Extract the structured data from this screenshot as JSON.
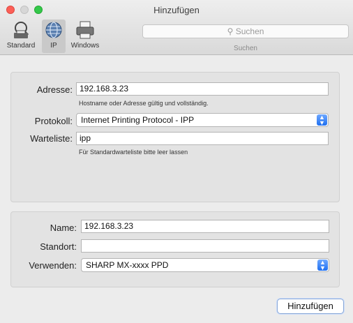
{
  "window": {
    "title": "Hinzufügen"
  },
  "toolbar": {
    "items": [
      {
        "label": "Standard",
        "icon": "default-printer-icon"
      },
      {
        "label": "IP",
        "icon": "globe-icon"
      },
      {
        "label": "Windows",
        "icon": "windows-printer-icon"
      }
    ],
    "search_placeholder": "Suchen",
    "search_caption": "Suchen"
  },
  "connection": {
    "address_label": "Adresse:",
    "address_value": "192.168.3.23",
    "address_hint": "Hostname oder Adresse gültig und vollständig.",
    "protocol_label": "Protokoll:",
    "protocol_value": "Internet Printing Protocol - IPP",
    "queue_label": "Warteliste:",
    "queue_value": "ipp",
    "queue_hint": "Für Standardwarteliste bitte leer lassen"
  },
  "printer": {
    "name_label": "Name:",
    "name_value": "192.168.3.23",
    "location_label": "Standort:",
    "location_value": "",
    "use_label": "Verwenden:",
    "use_value": "SHARP MX-xxxx PPD"
  },
  "footer": {
    "add_label": "Hinzufügen"
  },
  "colors": {
    "accent": "#1f6ff0",
    "close": "#fc5f57",
    "zoom": "#34c84a"
  }
}
